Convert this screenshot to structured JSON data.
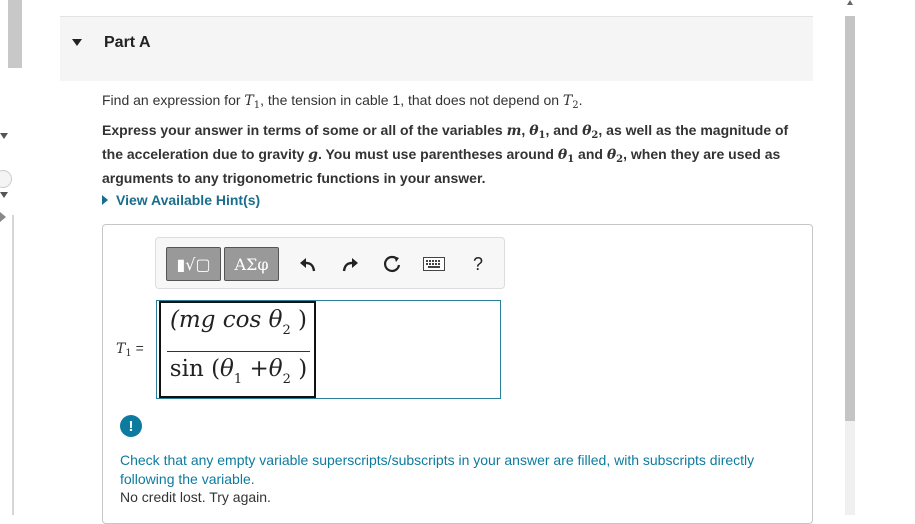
{
  "part": {
    "title": "Part A"
  },
  "question": {
    "prefix": "Find an expression for ",
    "var_T": "T",
    "var_T1_sub": "1",
    "middle": ", the tension in cable 1, that does not depend on ",
    "var_T2_sub": "2",
    "suffix": "."
  },
  "instructions": {
    "p1": "Express your answer in terms of some or all of the variables ",
    "var_m": "m",
    "sep1": ", ",
    "var_theta": "θ",
    "sub1": "1",
    "sep2": ", and ",
    "sub2": "2",
    "p2": ", as well as the magnitude of the acceleration due to gravity ",
    "var_g": "g",
    "p3": ". You must use parentheses around ",
    "p4": " and ",
    "p5": ", when they are used as arguments to any trigonometric functions in your answer."
  },
  "hint": {
    "label": "View Available Hint(s)"
  },
  "toolbar": {
    "templates_label": "▮√▢",
    "greek_label": "ΑΣφ",
    "help_label": "?"
  },
  "answer": {
    "label_var": "T",
    "label_sub": "1",
    "label_eq": " =",
    "numerator_open": "(mg cos ",
    "numerator_theta": "θ",
    "numerator_sub": "2",
    "numerator_close": " )",
    "denominator_open": "sin (",
    "denominator_theta1": "θ",
    "denominator_sub1": "1",
    "denominator_plus": " +",
    "denominator_theta2": "θ",
    "denominator_sub2": "2",
    "denominator_close": " )"
  },
  "feedback": {
    "message": "Check that any empty variable superscripts/subscripts in your answer are filled, with subscripts directly following the variable.",
    "status": "No credit lost. Try again."
  },
  "colors": {
    "accent": "#0d7b9f",
    "link": "#1a6d8c",
    "field_border": "#2a7f9a"
  }
}
